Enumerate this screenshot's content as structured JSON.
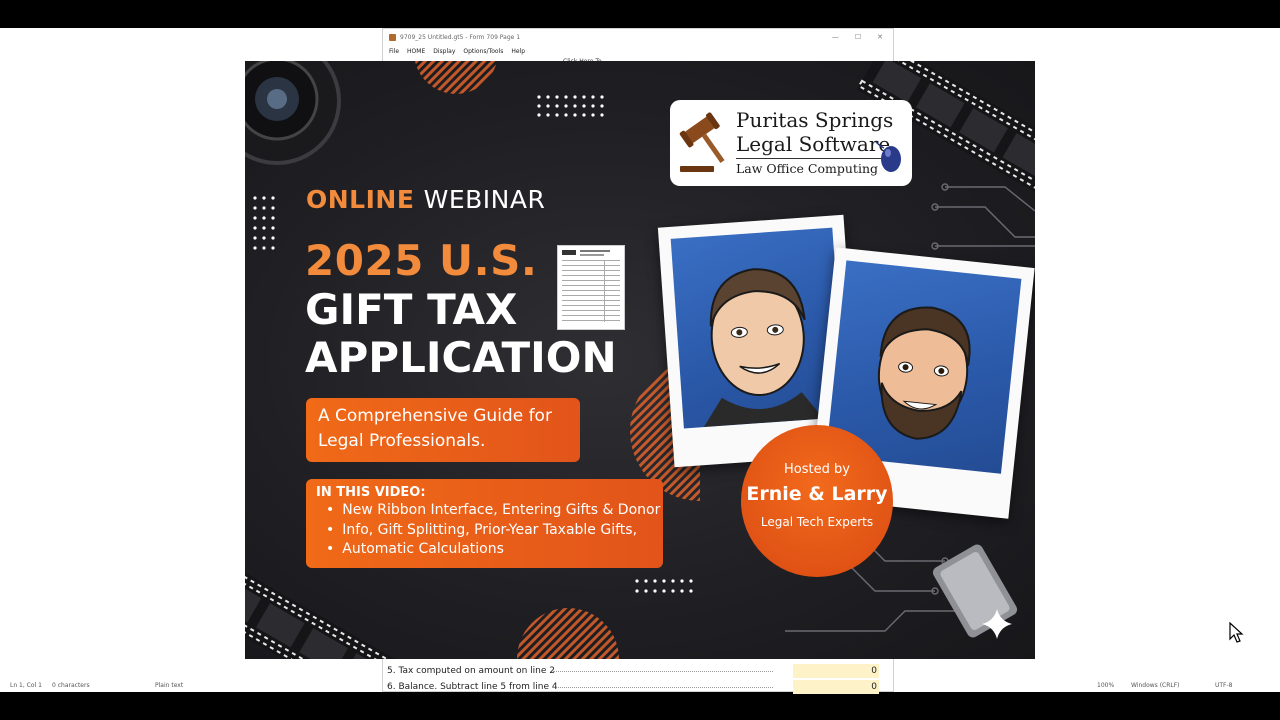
{
  "app_window": {
    "title": "9709_25 Untitled.gt5 - Form 709 Page 1",
    "menu": [
      "File",
      "HOME",
      "Display",
      "Options/Tools",
      "Help"
    ],
    "hint": "Click Here To",
    "rows": [
      {
        "label": "5. Tax computed on amount on line 2",
        "value": "0"
      },
      {
        "label": "6. Balance. Subtract line 5 from line 4",
        "value": "0"
      }
    ]
  },
  "statusbar": {
    "position": "Ln 1, Col 1",
    "chars": "0 characters",
    "format": "Plain text",
    "zoom": "100%",
    "line_ending": "Windows (CRLF)",
    "encoding": "UTF-8"
  },
  "poster": {
    "webinar_prefix": "ONLINE",
    "webinar_suffix": "WEBINAR",
    "year_line": "2025 U.S.",
    "title_line1": "GIFT TAX",
    "title_line2": "APPLICATION",
    "guide_line1": "A Comprehensive Guide for",
    "guide_line2": "Legal Professionals.",
    "video_heading": "IN THIS VIDEO:",
    "video_items": [
      "New Ribbon Interface, Entering Gifts & Donor",
      "Info, Gift Splitting, Prior-Year Taxable Gifts,",
      "Automatic Calculations"
    ],
    "logo_line1": "Puritas Springs",
    "logo_line2": "Legal Software",
    "logo_line3": "Law Office Computing",
    "host_label": "Hosted by",
    "host_names": "Ernie & Larry",
    "host_title": "Legal Tech Experts"
  },
  "colors": {
    "accent_orange": "#f28b3c",
    "button_orange": "#e8581a",
    "poster_bg": "#222226",
    "photo_bg": "#2f62b8"
  },
  "icons": [
    "gavel-icon",
    "mouse-icon",
    "camera-lens-icon",
    "film-strip-icon",
    "sparkle-icon",
    "cursor-icon"
  ]
}
